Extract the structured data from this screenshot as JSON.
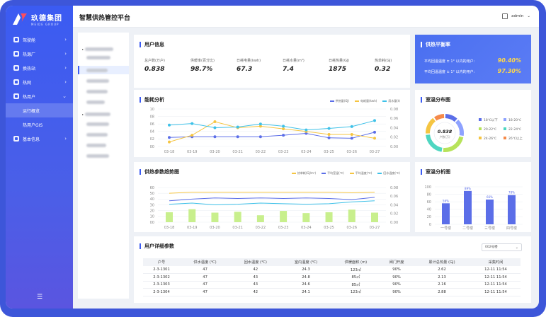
{
  "brand": {
    "name_cn": "玖德集团",
    "name_en": "MEIDE GROUP"
  },
  "app_title": "智慧供热管控平台",
  "user": {
    "name": "admin"
  },
  "sidebar": {
    "items": [
      {
        "label": "驾驶舱"
      },
      {
        "label": "热源厂"
      },
      {
        "label": "换热站"
      },
      {
        "label": "热网"
      },
      {
        "label": "热用户"
      }
    ],
    "sub_items": [
      {
        "label": "运行概览"
      },
      {
        "label": "热用户GIS"
      }
    ],
    "basic": {
      "label": "基本信息"
    }
  },
  "user_info": {
    "title": "用户信息",
    "items": [
      {
        "label": "总户数(万户)",
        "value": "0.838"
      },
      {
        "label": "供暖率(百分比)",
        "value": "98.7%"
      },
      {
        "label": "日耗电量(kwh)",
        "value": "67.3"
      },
      {
        "label": "日耗水量(m³)",
        "value": "7.4"
      },
      {
        "label": "日耗热量(GJ)",
        "value": "1875"
      },
      {
        "label": "热单耗(GJ)",
        "value": "0.32"
      }
    ]
  },
  "balance": {
    "title": "供热平衡率",
    "rows": [
      {
        "label": "平均回温温度 ± 1° 以内的用户:",
        "value": "90.40%"
      },
      {
        "label": "平均回温温度 ± 1° 以内的用户:",
        "value": "97.30%"
      }
    ]
  },
  "energy": {
    "title": "能耗分析",
    "legend": [
      "供热量(GJ)",
      "电耗量(kwh)",
      "用水量(t)"
    ],
    "colors": [
      "#5b6ee8",
      "#f5c542",
      "#3ec1e8"
    ]
  },
  "trend": {
    "title": "供热参数趋势图",
    "legend": [
      "热单耗(GJ/m²)",
      "平均室温(℃)",
      "平均温度(℃)",
      "回水温度(℃)"
    ]
  },
  "room_dist": {
    "title": "室温分布图",
    "center_value": "0.838",
    "center_label": "户数(万)",
    "legend": [
      "18℃以下",
      "18-20℃",
      "20-22℃",
      "22-24℃",
      "24-26℃",
      "26℃以上"
    ],
    "colors": [
      "#5b6ee8",
      "#8ea2ff",
      "#b7e35a",
      "#4fd6c1",
      "#f5c542",
      "#f58a4a"
    ]
  },
  "room_analysis": {
    "title": "室温分析图"
  },
  "detail": {
    "title": "用户详细参数",
    "select": "002号楼",
    "columns": [
      "户号",
      "供水温度 (℃)",
      "回水温度 (℃)",
      "室内温度 (℃)",
      "供暖面积 (m)",
      "阀门开度",
      "累计总热量 (GJ)",
      "采集时间"
    ],
    "rows": [
      [
        "2-3-1301",
        "47",
        "42",
        "24.3",
        "123㎡",
        "90%",
        "2.62",
        "12-11 11:54"
      ],
      [
        "2-3-1302",
        "47",
        "43",
        "24.8",
        "85㎡",
        "90%",
        "2.13",
        "12-11 11:54"
      ],
      [
        "2-3-1303",
        "47",
        "43",
        "24.6",
        "85㎡",
        "90%",
        "2.16",
        "12-11 11:54"
      ],
      [
        "2-3-1304",
        "47",
        "42",
        "24.1",
        "123㎡",
        "90%",
        "2.88",
        "12-11 11:54"
      ]
    ]
  },
  "chart_data": [
    {
      "type": "line",
      "title": "能耗分析",
      "x": [
        "03-18",
        "03-19",
        "03-20",
        "03-21",
        "03-22",
        "03-23",
        "03-24",
        "03-25",
        "03-26",
        "03-27"
      ],
      "ylim_left": [
        0,
        10
      ],
      "yticks_left": [
        "10",
        "08",
        "06",
        "04",
        "02",
        "00"
      ],
      "ylim_right": [
        0,
        0.08
      ],
      "yticks_right": [
        "0.08",
        "0.06",
        "0.04",
        "0.02",
        "0.00"
      ],
      "series": [
        {
          "name": "供热量(GJ)",
          "values": [
            2.4,
            2.6,
            2.6,
            2.6,
            2.6,
            3.0,
            3.5,
            2.3,
            2.2,
            3.8
          ]
        },
        {
          "name": "电耗量(kwh)",
          "values": [
            1.2,
            3.0,
            6.6,
            5.0,
            5.4,
            4.7,
            4.0,
            3.2,
            3.2,
            2.2
          ]
        },
        {
          "name": "用水量(t)",
          "values": [
            5.7,
            6.1,
            5.0,
            5.2,
            6.0,
            5.4,
            4.4,
            4.8,
            5.3,
            6.9
          ]
        }
      ]
    },
    {
      "type": "bar",
      "title": "供热参数趋势图",
      "x": [
        "03-18",
        "03-19",
        "03-20",
        "03-21",
        "03-22",
        "03-23",
        "03-24",
        "03-25",
        "03-26",
        "03-27"
      ],
      "ylim_left": [
        0,
        60
      ],
      "yticks_left": [
        "60",
        "50",
        "40",
        "30",
        "20",
        "10",
        "00"
      ],
      "ylim_right": [
        0,
        0.08
      ],
      "yticks_right": [
        "0.08",
        "0.06",
        "0.04",
        "0.02",
        "0.00"
      ],
      "bars": {
        "name": "热单耗(GJ/m²)",
        "values": [
          0.023,
          0.03,
          0.022,
          0.024,
          0.016,
          0.026,
          0.021,
          0.023,
          0.029,
          0.022
        ]
      },
      "series": [
        {
          "name": "平均室温(℃)",
          "values": [
            50,
            52,
            52,
            52,
            52,
            52,
            52,
            52,
            51,
            52
          ]
        },
        {
          "name": "平均温度(℃)",
          "values": [
            37,
            40,
            42,
            41,
            42,
            41,
            42,
            41,
            39,
            43
          ]
        },
        {
          "name": "回水温度(℃)",
          "values": [
            31,
            33,
            30,
            31,
            33,
            32,
            31,
            32,
            35,
            37
          ]
        }
      ]
    },
    {
      "type": "pie",
      "title": "室温分布图",
      "categories": [
        "18℃以下",
        "18-20℃",
        "20-22℃",
        "22-24℃",
        "24-26℃",
        "26℃以上"
      ],
      "values": [
        12,
        16,
        24,
        22,
        16,
        10
      ]
    },
    {
      "type": "bar",
      "title": "室温分析图",
      "categories": [
        "一号楼",
        "二号楼",
        "三号楼",
        "四号楼"
      ],
      "values": [
        56,
        89,
        66,
        78
      ],
      "data_labels": [
        "56%",
        "89%",
        "66%",
        "78%"
      ],
      "ylim": [
        0,
        100
      ],
      "yticks": [
        "100",
        "80",
        "60",
        "40",
        "20",
        "0"
      ]
    }
  ]
}
